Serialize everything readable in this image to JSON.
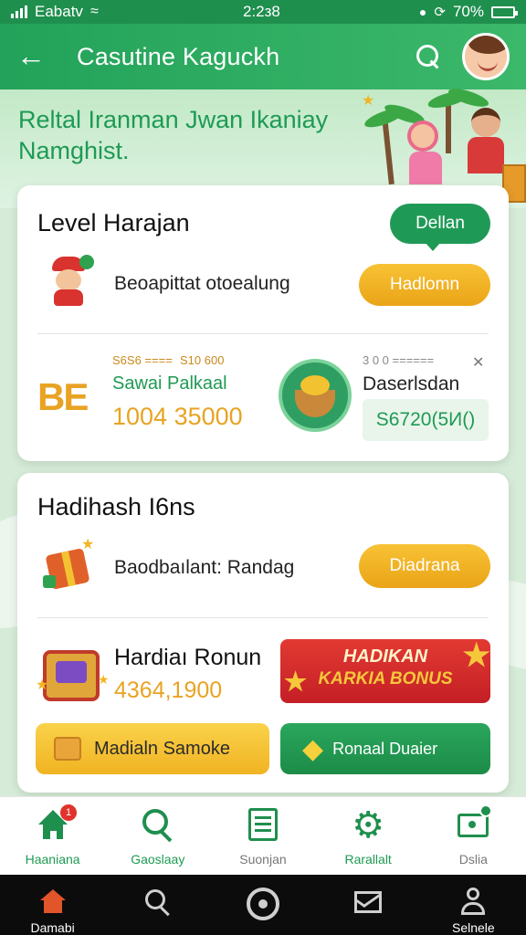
{
  "status_bar": {
    "carrier": "Eabatv",
    "time": "2:2з8",
    "battery_text": "70%"
  },
  "app_bar": {
    "title": "Casutine Kaguckh"
  },
  "hero": {
    "text": "Reltal Iranman Jwan Ikaniay Namghist."
  },
  "level_card": {
    "title": "Level Harajan",
    "bubble_button": "Dellan",
    "row1_text": "Beoapittat otoealung",
    "row1_button": "Hadlomn",
    "logo_text": "BE",
    "small_left_1": "S6S6 ====",
    "small_left_2": "S10 600",
    "stat_label": "Sawai Palkaal",
    "stat_value": "1004 35000",
    "small_right": "3 0 0 ======",
    "right_label": "Daserlsdan",
    "right_value": "S6720(5И()"
  },
  "bonus_card": {
    "title": "Hadihash I6ns",
    "row1_text": "Baodbaılant: Randag",
    "row1_button": "Diadrana",
    "bonus_title": "Hardiaı Ronun",
    "bonus_value": "4364,1900",
    "banner_line1": "HADIKAN",
    "banner_line2": "KARKIA BONUS",
    "yellow_button": "Madialn Samoke",
    "green_button": "Ronaal Duaier"
  },
  "bottom_nav": {
    "items": [
      {
        "label": "Haaniana",
        "icon": "home-icon",
        "badge": "1"
      },
      {
        "label": "Gaoslaay",
        "icon": "search-icon"
      },
      {
        "label": "Suonjan",
        "icon": "list-icon"
      },
      {
        "label": "Rarallalt",
        "icon": "gear-icon"
      },
      {
        "label": "Dslia",
        "icon": "message-icon"
      }
    ]
  },
  "system_bar": {
    "items": [
      {
        "label": "Damabi",
        "icon": "home-icon"
      },
      {
        "label": "",
        "icon": "search-icon"
      },
      {
        "label": "",
        "icon": "record-icon"
      },
      {
        "label": "",
        "icon": "mail-icon"
      },
      {
        "label": "Selnele",
        "icon": "person-icon"
      }
    ]
  },
  "colors": {
    "primary": "#22a25a",
    "accent_orange": "#f2b526",
    "bonus_red": "#d9272d"
  }
}
